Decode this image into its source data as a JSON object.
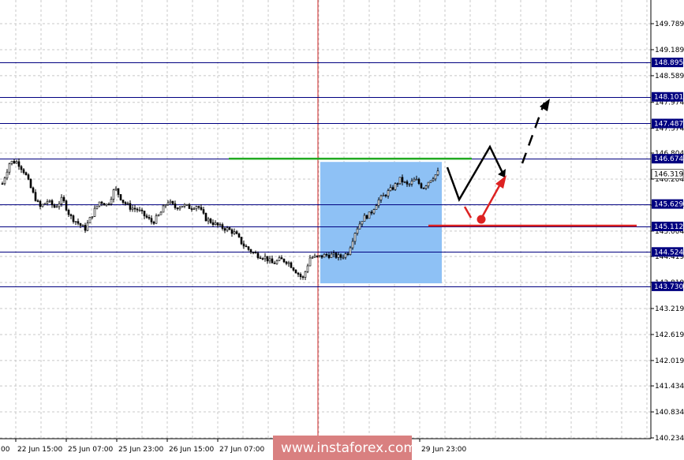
{
  "chart_data": {
    "type": "candlestick",
    "y_ticks": [
      "149.789",
      "149.189",
      "148.589",
      "147.974",
      "147.374",
      "146.804",
      "146.204",
      "145.604",
      "145.004",
      "144.419",
      "143.819",
      "143.219",
      "142.619",
      "142.019",
      "141.434",
      "140.834",
      "140.234"
    ],
    "x_labels": [
      "22 Jun 15:00",
      "25 Jun 07:00",
      "25 Jun 23:00",
      "26 Jun 15:00",
      "27 Jun 07:00",
      "29 Jun 23:00"
    ],
    "levels": [
      {
        "label": "148.895",
        "value": 148.895
      },
      {
        "label": "148.101",
        "value": 148.101
      },
      {
        "label": "147.487",
        "value": 147.487
      },
      {
        "label": "146.674",
        "value": 146.674
      },
      {
        "label": "145.629",
        "value": 145.629
      },
      {
        "label": "145.112",
        "value": 145.112
      },
      {
        "label": "144.524",
        "value": 144.524
      },
      {
        "label": "143.730",
        "value": 143.73
      }
    ],
    "current_price": {
      "label": "146.319",
      "value": 146.319
    },
    "highlight_zone": {
      "from_value": 146.6,
      "to_value": 143.8
    },
    "resistance_line": {
      "value": 146.674,
      "color": "#22aa22"
    },
    "support_line": {
      "value": 145.112,
      "color": "#dd2222"
    },
    "close_path": [
      146.1,
      146.6,
      146.6,
      146.35,
      145.9,
      145.55,
      145.7,
      145.55,
      145.75,
      145.35,
      145.2,
      145.05,
      145.4,
      145.7,
      145.6,
      146.0,
      145.7,
      145.55,
      145.5,
      145.35,
      145.2,
      145.4,
      145.7,
      145.55,
      145.6,
      145.55,
      145.6,
      145.3,
      145.2,
      145.1,
      145.05,
      144.95,
      144.7,
      144.55,
      144.45,
      144.4,
      144.25,
      144.35,
      144.3,
      144.1,
      143.9,
      144.4,
      144.4,
      144.45,
      144.45,
      144.4,
      144.5,
      145.0,
      145.3,
      145.4,
      145.7,
      145.85,
      146.0,
      146.2,
      146.05,
      146.2,
      146.0,
      146.2,
      146.35
    ]
  },
  "colors": {
    "level_line": "#000080",
    "label_bg": "#000080",
    "grid": "#c0c0c0",
    "vertical_marker": "#cc2222",
    "zone": "#8ec1f5",
    "price_axis_bg": "#ffffff",
    "watermark_bg": "#d98080"
  },
  "watermark": {
    "text": "www.instaforex.com"
  },
  "x_left_partial": "00"
}
